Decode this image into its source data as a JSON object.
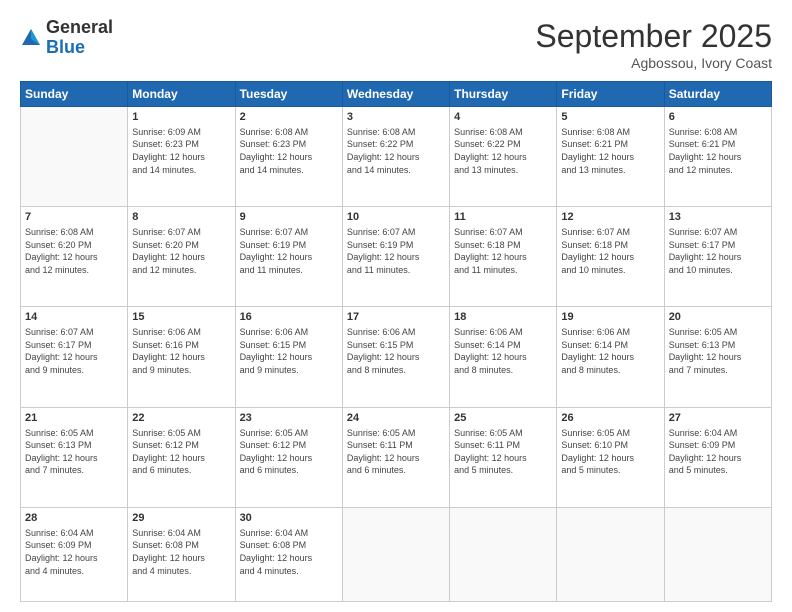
{
  "header": {
    "logo_general": "General",
    "logo_blue": "Blue",
    "month_title": "September 2025",
    "location": "Agbossou, Ivory Coast"
  },
  "days_of_week": [
    "Sunday",
    "Monday",
    "Tuesday",
    "Wednesday",
    "Thursday",
    "Friday",
    "Saturday"
  ],
  "weeks": [
    [
      {
        "day": "",
        "info": ""
      },
      {
        "day": "1",
        "info": "Sunrise: 6:09 AM\nSunset: 6:23 PM\nDaylight: 12 hours\nand 14 minutes."
      },
      {
        "day": "2",
        "info": "Sunrise: 6:08 AM\nSunset: 6:23 PM\nDaylight: 12 hours\nand 14 minutes."
      },
      {
        "day": "3",
        "info": "Sunrise: 6:08 AM\nSunset: 6:22 PM\nDaylight: 12 hours\nand 14 minutes."
      },
      {
        "day": "4",
        "info": "Sunrise: 6:08 AM\nSunset: 6:22 PM\nDaylight: 12 hours\nand 13 minutes."
      },
      {
        "day": "5",
        "info": "Sunrise: 6:08 AM\nSunset: 6:21 PM\nDaylight: 12 hours\nand 13 minutes."
      },
      {
        "day": "6",
        "info": "Sunrise: 6:08 AM\nSunset: 6:21 PM\nDaylight: 12 hours\nand 12 minutes."
      }
    ],
    [
      {
        "day": "7",
        "info": "Sunrise: 6:08 AM\nSunset: 6:20 PM\nDaylight: 12 hours\nand 12 minutes."
      },
      {
        "day": "8",
        "info": "Sunrise: 6:07 AM\nSunset: 6:20 PM\nDaylight: 12 hours\nand 12 minutes."
      },
      {
        "day": "9",
        "info": "Sunrise: 6:07 AM\nSunset: 6:19 PM\nDaylight: 12 hours\nand 11 minutes."
      },
      {
        "day": "10",
        "info": "Sunrise: 6:07 AM\nSunset: 6:19 PM\nDaylight: 12 hours\nand 11 minutes."
      },
      {
        "day": "11",
        "info": "Sunrise: 6:07 AM\nSunset: 6:18 PM\nDaylight: 12 hours\nand 11 minutes."
      },
      {
        "day": "12",
        "info": "Sunrise: 6:07 AM\nSunset: 6:18 PM\nDaylight: 12 hours\nand 10 minutes."
      },
      {
        "day": "13",
        "info": "Sunrise: 6:07 AM\nSunset: 6:17 PM\nDaylight: 12 hours\nand 10 minutes."
      }
    ],
    [
      {
        "day": "14",
        "info": "Sunrise: 6:07 AM\nSunset: 6:17 PM\nDaylight: 12 hours\nand 9 minutes."
      },
      {
        "day": "15",
        "info": "Sunrise: 6:06 AM\nSunset: 6:16 PM\nDaylight: 12 hours\nand 9 minutes."
      },
      {
        "day": "16",
        "info": "Sunrise: 6:06 AM\nSunset: 6:15 PM\nDaylight: 12 hours\nand 9 minutes."
      },
      {
        "day": "17",
        "info": "Sunrise: 6:06 AM\nSunset: 6:15 PM\nDaylight: 12 hours\nand 8 minutes."
      },
      {
        "day": "18",
        "info": "Sunrise: 6:06 AM\nSunset: 6:14 PM\nDaylight: 12 hours\nand 8 minutes."
      },
      {
        "day": "19",
        "info": "Sunrise: 6:06 AM\nSunset: 6:14 PM\nDaylight: 12 hours\nand 8 minutes."
      },
      {
        "day": "20",
        "info": "Sunrise: 6:05 AM\nSunset: 6:13 PM\nDaylight: 12 hours\nand 7 minutes."
      }
    ],
    [
      {
        "day": "21",
        "info": "Sunrise: 6:05 AM\nSunset: 6:13 PM\nDaylight: 12 hours\nand 7 minutes."
      },
      {
        "day": "22",
        "info": "Sunrise: 6:05 AM\nSunset: 6:12 PM\nDaylight: 12 hours\nand 6 minutes."
      },
      {
        "day": "23",
        "info": "Sunrise: 6:05 AM\nSunset: 6:12 PM\nDaylight: 12 hours\nand 6 minutes."
      },
      {
        "day": "24",
        "info": "Sunrise: 6:05 AM\nSunset: 6:11 PM\nDaylight: 12 hours\nand 6 minutes."
      },
      {
        "day": "25",
        "info": "Sunrise: 6:05 AM\nSunset: 6:11 PM\nDaylight: 12 hours\nand 5 minutes."
      },
      {
        "day": "26",
        "info": "Sunrise: 6:05 AM\nSunset: 6:10 PM\nDaylight: 12 hours\nand 5 minutes."
      },
      {
        "day": "27",
        "info": "Sunrise: 6:04 AM\nSunset: 6:09 PM\nDaylight: 12 hours\nand 5 minutes."
      }
    ],
    [
      {
        "day": "28",
        "info": "Sunrise: 6:04 AM\nSunset: 6:09 PM\nDaylight: 12 hours\nand 4 minutes."
      },
      {
        "day": "29",
        "info": "Sunrise: 6:04 AM\nSunset: 6:08 PM\nDaylight: 12 hours\nand 4 minutes."
      },
      {
        "day": "30",
        "info": "Sunrise: 6:04 AM\nSunset: 6:08 PM\nDaylight: 12 hours\nand 4 minutes."
      },
      {
        "day": "",
        "info": ""
      },
      {
        "day": "",
        "info": ""
      },
      {
        "day": "",
        "info": ""
      },
      {
        "day": "",
        "info": ""
      }
    ]
  ]
}
